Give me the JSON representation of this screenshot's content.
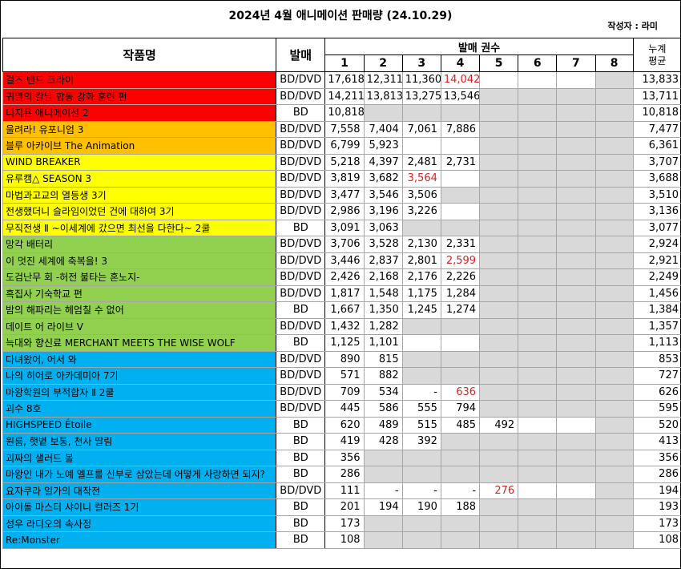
{
  "title": "2024년 4월 애니메이션 판매량 (24.10.29)",
  "author": "작성자 : 라미",
  "headers": {
    "work": "작품명",
    "release": "발매",
    "volumes": "발매 권수",
    "volume_nums": [
      "1",
      "2",
      "3",
      "4",
      "5",
      "6",
      "7",
      "8"
    ],
    "avg_line1": "누계",
    "avg_line2": "평균"
  },
  "colors": {
    "red": "#ff0000",
    "orange": "#ffc000",
    "yellow": "#ffff00",
    "green": "#92d050",
    "blue": "#00b0f0",
    "gray": "#d9d9d9",
    "highlight_text": "#e02020"
  },
  "rows": [
    {
      "name": "걸즈 밴드 크라이",
      "fmt": "BD/DVD",
      "v": [
        "17,618",
        "12,311",
        "11,360",
        "14,042",
        "",
        "",
        "",
        ""
      ],
      "avg": "13,833",
      "group": "red",
      "red_cols": [
        3
      ],
      "gray_cols": [
        7
      ]
    },
    {
      "name": "귀멸의 칼날 합동 강화 훈련 편",
      "fmt": "BD/DVD",
      "v": [
        "14,211",
        "13,813",
        "13,275",
        "13,546",
        "",
        "",
        "",
        ""
      ],
      "avg": "13,711",
      "group": "red",
      "red_cols": [],
      "gray_cols": [
        4,
        5,
        6,
        7
      ]
    },
    {
      "name": "니지욘 애니메이션 2",
      "fmt": "BD",
      "v": [
        "10,818",
        "",
        "",
        "",
        "",
        "",
        "",
        ""
      ],
      "avg": "10,818",
      "group": "red",
      "red_cols": [],
      "gray_cols": [
        1,
        2,
        3,
        4,
        5,
        6,
        7
      ]
    },
    {
      "name": "울려라! 유포니엄 3",
      "fmt": "BD/DVD",
      "v": [
        "7,558",
        "7,404",
        "7,061",
        "7,886",
        "",
        "",
        "",
        ""
      ],
      "avg": "7,477",
      "group": "orange",
      "red_cols": [],
      "gray_cols": [
        4,
        5,
        6,
        7
      ]
    },
    {
      "name": "블루 아카이브 The Animation",
      "fmt": "BD/DVD",
      "v": [
        "6,799",
        "5,923",
        "",
        "",
        "",
        "",
        "",
        ""
      ],
      "avg": "6,361",
      "group": "orange",
      "red_cols": [],
      "gray_cols": [
        4,
        5,
        6,
        7
      ]
    },
    {
      "name": "WIND BREAKER",
      "fmt": "BD/DVD",
      "v": [
        "5,218",
        "4,397",
        "2,481",
        "2,731",
        "",
        "",
        "",
        ""
      ],
      "avg": "3,707",
      "group": "yellow",
      "red_cols": [],
      "gray_cols": [
        4,
        5,
        6,
        7
      ]
    },
    {
      "name": "유루캠△ SEASON 3",
      "fmt": "BD/DVD",
      "v": [
        "3,819",
        "3,682",
        "3,564",
        "",
        "",
        "",
        "",
        ""
      ],
      "avg": "3,688",
      "group": "yellow",
      "red_cols": [
        2
      ],
      "gray_cols": [
        4,
        5,
        6,
        7
      ]
    },
    {
      "name": "마법과고교의 열등생 3기",
      "fmt": "BD/DVD",
      "v": [
        "3,477",
        "3,546",
        "3,506",
        "",
        "",
        "",
        "",
        ""
      ],
      "avg": "3,510",
      "group": "yellow",
      "red_cols": [],
      "gray_cols": [
        3,
        4,
        5,
        6,
        7
      ]
    },
    {
      "name": "전생했더니 슬라임이었던 건에 대하여 3기",
      "fmt": "BD/DVD",
      "v": [
        "2,986",
        "3,196",
        "3,226",
        "",
        "",
        "",
        "",
        ""
      ],
      "avg": "3,136",
      "group": "yellow",
      "red_cols": [],
      "gray_cols": [
        4,
        5,
        6,
        7
      ]
    },
    {
      "name": "무직전생 Ⅱ ~이세계에 갔으면 최선을 다한다~ 2쿨",
      "fmt": "BD",
      "v": [
        "3,091",
        "3,063",
        "",
        "",
        "",
        "",
        "",
        ""
      ],
      "avg": "3,077",
      "group": "yellow",
      "red_cols": [],
      "gray_cols": [
        2,
        3,
        4,
        5,
        6,
        7
      ]
    },
    {
      "name": "망각 배터리",
      "fmt": "BD/DVD",
      "v": [
        "3,706",
        "3,528",
        "2,130",
        "2,331",
        "",
        "",
        "",
        ""
      ],
      "avg": "2,924",
      "group": "green",
      "red_cols": [],
      "gray_cols": [
        4,
        5,
        6,
        7
      ]
    },
    {
      "name": "이 멋진 세계에 축복을! 3",
      "fmt": "BD/DVD",
      "v": [
        "3,446",
        "2,837",
        "2,801",
        "2,599",
        "",
        "",
        "",
        ""
      ],
      "avg": "2,921",
      "group": "green",
      "red_cols": [
        3
      ],
      "gray_cols": [
        4,
        5,
        6,
        7
      ]
    },
    {
      "name": "도검난무 회 -허전 불타는 혼노지-",
      "fmt": "BD/DVD",
      "v": [
        "2,426",
        "2,168",
        "2,176",
        "2,226",
        "",
        "",
        "",
        ""
      ],
      "avg": "2,249",
      "group": "green",
      "red_cols": [],
      "gray_cols": [
        4,
        5,
        6,
        7
      ]
    },
    {
      "name": "흑집사 기숙학교 편",
      "fmt": "BD/DVD",
      "v": [
        "1,817",
        "1,548",
        "1,175",
        "1,284",
        "",
        "",
        "",
        ""
      ],
      "avg": "1,456",
      "group": "green",
      "red_cols": [],
      "gray_cols": [
        4,
        5,
        6,
        7
      ]
    },
    {
      "name": "밤의 해파리는 헤엄칠 수 없어",
      "fmt": "BD",
      "v": [
        "1,667",
        "1,350",
        "1,245",
        "1,274",
        "",
        "",
        "",
        ""
      ],
      "avg": "1,384",
      "group": "green",
      "red_cols": [],
      "gray_cols": [
        4,
        5,
        6,
        7
      ]
    },
    {
      "name": "데이트 어 라이브 V",
      "fmt": "BD/DVD",
      "v": [
        "1,432",
        "1,282",
        "",
        "",
        "",
        "",
        "",
        ""
      ],
      "avg": "1,357",
      "group": "green",
      "red_cols": [],
      "gray_cols": [
        2,
        3,
        4,
        5,
        6,
        7
      ]
    },
    {
      "name": "늑대와 향신료 MERCHANT MEETS THE WISE WOLF",
      "fmt": "BD",
      "v": [
        "1,125",
        "1,101",
        "",
        "",
        "",
        "",
        "",
        ""
      ],
      "avg": "1,113",
      "group": "green",
      "red_cols": [],
      "gray_cols": [
        4,
        5,
        6,
        7
      ]
    },
    {
      "name": "다녀왔어, 어서 와",
      "fmt": "BD/DVD",
      "v": [
        "890",
        "815",
        "",
        "",
        "",
        "",
        "",
        ""
      ],
      "avg": "853",
      "group": "blue",
      "red_cols": [],
      "gray_cols": [
        2,
        3,
        4,
        5,
        6,
        7
      ]
    },
    {
      "name": "나의 히어로 아카데미아 7기",
      "fmt": "BD/DVD",
      "v": [
        "571",
        "882",
        "",
        "",
        "",
        "",
        "",
        ""
      ],
      "avg": "727",
      "group": "blue",
      "red_cols": [],
      "gray_cols": [
        2,
        3,
        4,
        5,
        6,
        7
      ]
    },
    {
      "name": "마왕학원의 부적합자 Ⅱ 2쿨",
      "fmt": "BD/DVD",
      "v": [
        "709",
        "534",
        "-",
        "636",
        "",
        "",
        "",
        ""
      ],
      "avg": "626",
      "group": "blue",
      "red_cols": [
        3
      ],
      "gray_cols": [
        4,
        5,
        6,
        7
      ]
    },
    {
      "name": "괴수 8호",
      "fmt": "BD/DVD",
      "v": [
        "445",
        "586",
        "555",
        "794",
        "",
        "",
        "",
        ""
      ],
      "avg": "595",
      "group": "blue",
      "red_cols": [],
      "gray_cols": [
        4,
        5,
        6,
        7
      ]
    },
    {
      "name": "HIGHSPEED Étoile",
      "fmt": "BD",
      "v": [
        "620",
        "489",
        "515",
        "485",
        "492",
        "",
        "",
        ""
      ],
      "avg": "520",
      "group": "blue",
      "red_cols": [],
      "gray_cols": [
        7
      ]
    },
    {
      "name": "원룸, 햇볕 보통, 천사 딸림",
      "fmt": "BD",
      "v": [
        "419",
        "428",
        "392",
        "",
        "",
        "",
        "",
        ""
      ],
      "avg": "413",
      "group": "blue",
      "red_cols": [],
      "gray_cols": [
        3,
        4,
        5,
        6,
        7
      ]
    },
    {
      "name": "괴짜의 샐러드 볼",
      "fmt": "BD",
      "v": [
        "356",
        "",
        "",
        "",
        "",
        "",
        "",
        ""
      ],
      "avg": "356",
      "group": "blue",
      "red_cols": [],
      "gray_cols": [
        1,
        2,
        3,
        4,
        5,
        6,
        7
      ]
    },
    {
      "name": "마왕인 내가 노예 엘프를 신부로 삼았는데 어떻게 사랑하면 되지?",
      "fmt": "BD",
      "v": [
        "286",
        "",
        "",
        "",
        "",
        "",
        "",
        ""
      ],
      "avg": "286",
      "group": "blue",
      "red_cols": [],
      "gray_cols": [
        1,
        2,
        3,
        4,
        5,
        6,
        7
      ]
    },
    {
      "name": "요자쿠라 일가의 대작전",
      "fmt": "BD/DVD",
      "v": [
        "111",
        "-",
        "-",
        "-",
        "276",
        "",
        "",
        ""
      ],
      "avg": "194",
      "group": "blue",
      "red_cols": [
        4
      ],
      "gray_cols": [
        7
      ]
    },
    {
      "name": "아이돌 마스터 샤이니 컬러즈 1기",
      "fmt": "BD",
      "v": [
        "201",
        "194",
        "190",
        "188",
        "",
        "",
        "",
        ""
      ],
      "avg": "193",
      "group": "blue",
      "red_cols": [],
      "gray_cols": [
        4,
        5,
        6,
        7
      ]
    },
    {
      "name": "성우 라디오의 속사정",
      "fmt": "BD",
      "v": [
        "173",
        "",
        "",
        "",
        "",
        "",
        "",
        ""
      ],
      "avg": "173",
      "group": "blue",
      "red_cols": [],
      "gray_cols": [
        1,
        2,
        3,
        4,
        5,
        6,
        7
      ]
    },
    {
      "name": "Re:Monster",
      "fmt": "BD",
      "v": [
        "108",
        "",
        "",
        "",
        "",
        "",
        "",
        ""
      ],
      "avg": "108",
      "group": "blue",
      "red_cols": [],
      "gray_cols": [
        1,
        2,
        3,
        4,
        5,
        6,
        7
      ]
    }
  ]
}
